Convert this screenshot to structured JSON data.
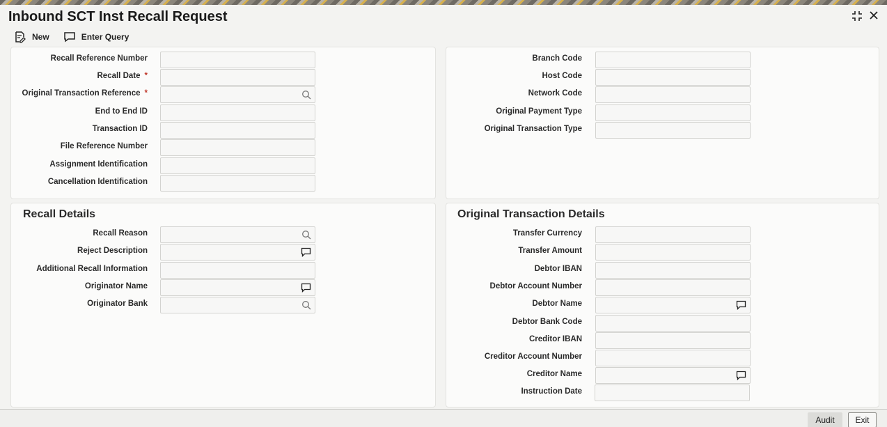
{
  "window": {
    "title": "Inbound SCT Inst Recall Request"
  },
  "toolbar": {
    "new_label": "New",
    "enter_query_label": "Enter Query"
  },
  "main_left": {
    "fields": [
      {
        "label": "Recall Reference Number",
        "required": ""
      },
      {
        "label": "Recall Date",
        "required": "*"
      },
      {
        "label": "Original Transaction Reference",
        "required": "*"
      },
      {
        "label": "End to End ID",
        "required": ""
      },
      {
        "label": "Transaction ID",
        "required": ""
      },
      {
        "label": "File Reference Number",
        "required": ""
      },
      {
        "label": "Assignment Identification",
        "required": ""
      },
      {
        "label": "Cancellation Identification",
        "required": ""
      }
    ]
  },
  "main_right": {
    "fields": [
      {
        "label": "Branch Code"
      },
      {
        "label": "Host Code"
      },
      {
        "label": "Network Code"
      },
      {
        "label": "Original Payment Type"
      },
      {
        "label": "Original Transaction Type"
      }
    ]
  },
  "recall_details": {
    "title": "Recall Details",
    "fields": [
      {
        "label": "Recall Reason"
      },
      {
        "label": "Reject Description"
      },
      {
        "label": "Additional Recall Information"
      },
      {
        "label": "Originator Name"
      },
      {
        "label": "Originator Bank"
      }
    ]
  },
  "original_transaction_details": {
    "title": "Original Transaction Details",
    "fields": [
      {
        "label": "Transfer Currency"
      },
      {
        "label": "Transfer Amount"
      },
      {
        "label": "Debtor IBAN"
      },
      {
        "label": "Debtor Account Number"
      },
      {
        "label": "Debtor Name"
      },
      {
        "label": "Debtor Bank Code"
      },
      {
        "label": "Creditor IBAN"
      },
      {
        "label": "Creditor Account Number"
      },
      {
        "label": "Creditor Name"
      },
      {
        "label": "Instruction Date"
      }
    ]
  },
  "footer": {
    "audit_label": "Audit",
    "exit_label": "Exit"
  },
  "colors": {
    "panel_bg": "#fbfbfa",
    "page_bg": "#f3f3f1",
    "field_border": "#d3d3d0",
    "required": "#c0392b"
  }
}
